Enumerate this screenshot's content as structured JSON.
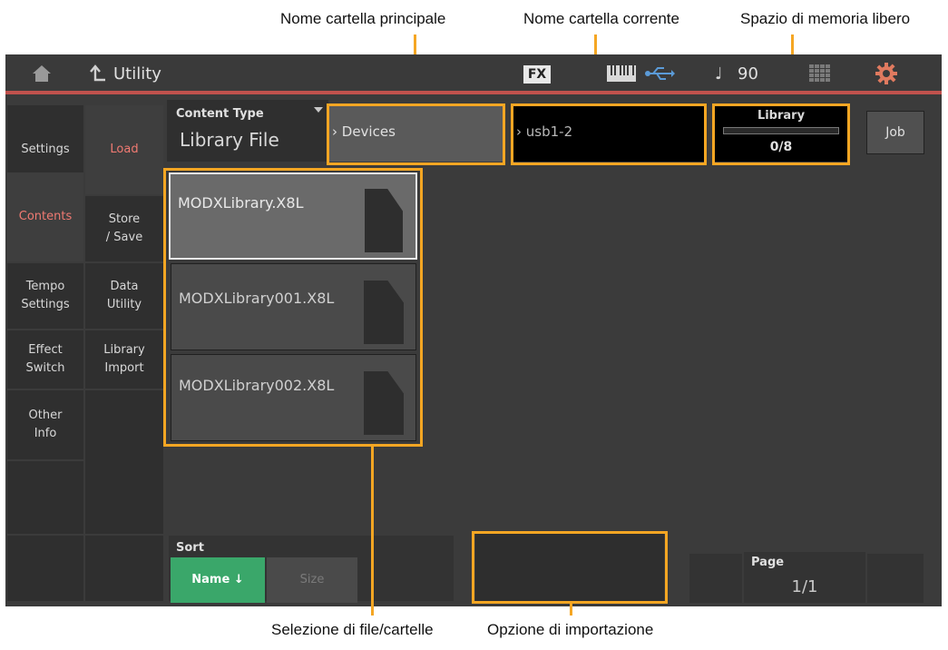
{
  "annotations": {
    "parent_folder": "Nome cartella principale",
    "current_folder": "Nome cartella corrente",
    "free_space": "Spazio di memoria libero",
    "file_select": "Selezione di file/cartelle",
    "import_option": "Opzione di importazione"
  },
  "topbar": {
    "title": "Utility",
    "fx": "FX",
    "tempo": "90",
    "icons": [
      "home-icon",
      "back-arrow-icon",
      "keyboard-icon",
      "usb-icon",
      "note-icon",
      "grid-icon",
      "gear-icon"
    ]
  },
  "sidebar_left": [
    "Settings",
    "Contents",
    "Tempo\nSettings",
    "Effect\nSwitch",
    "Other\nInfo"
  ],
  "sidebar_right": [
    "Load",
    "Store\n/ Save",
    "Data\nUtility",
    "Library\nImport"
  ],
  "content_type": {
    "label": "Content Type",
    "value": "Library File"
  },
  "path": {
    "parent": "Devices",
    "current": "usb1-2"
  },
  "library": {
    "label": "Library",
    "value": "0/8",
    "fill": 0
  },
  "job_label": "Job",
  "files": [
    "MODXLibrary.X8L",
    "MODXLibrary001.X8L",
    "MODXLibrary002.X8L"
  ],
  "sort": {
    "label": "Sort",
    "name": "Name ↓",
    "size": "Size"
  },
  "page": {
    "label": "Page",
    "value": "1/1"
  },
  "colors": {
    "accent_orange": "#f5a623",
    "active_red": "#f07a72",
    "green": "#3aa76a",
    "divider_red": "#c1524d"
  }
}
